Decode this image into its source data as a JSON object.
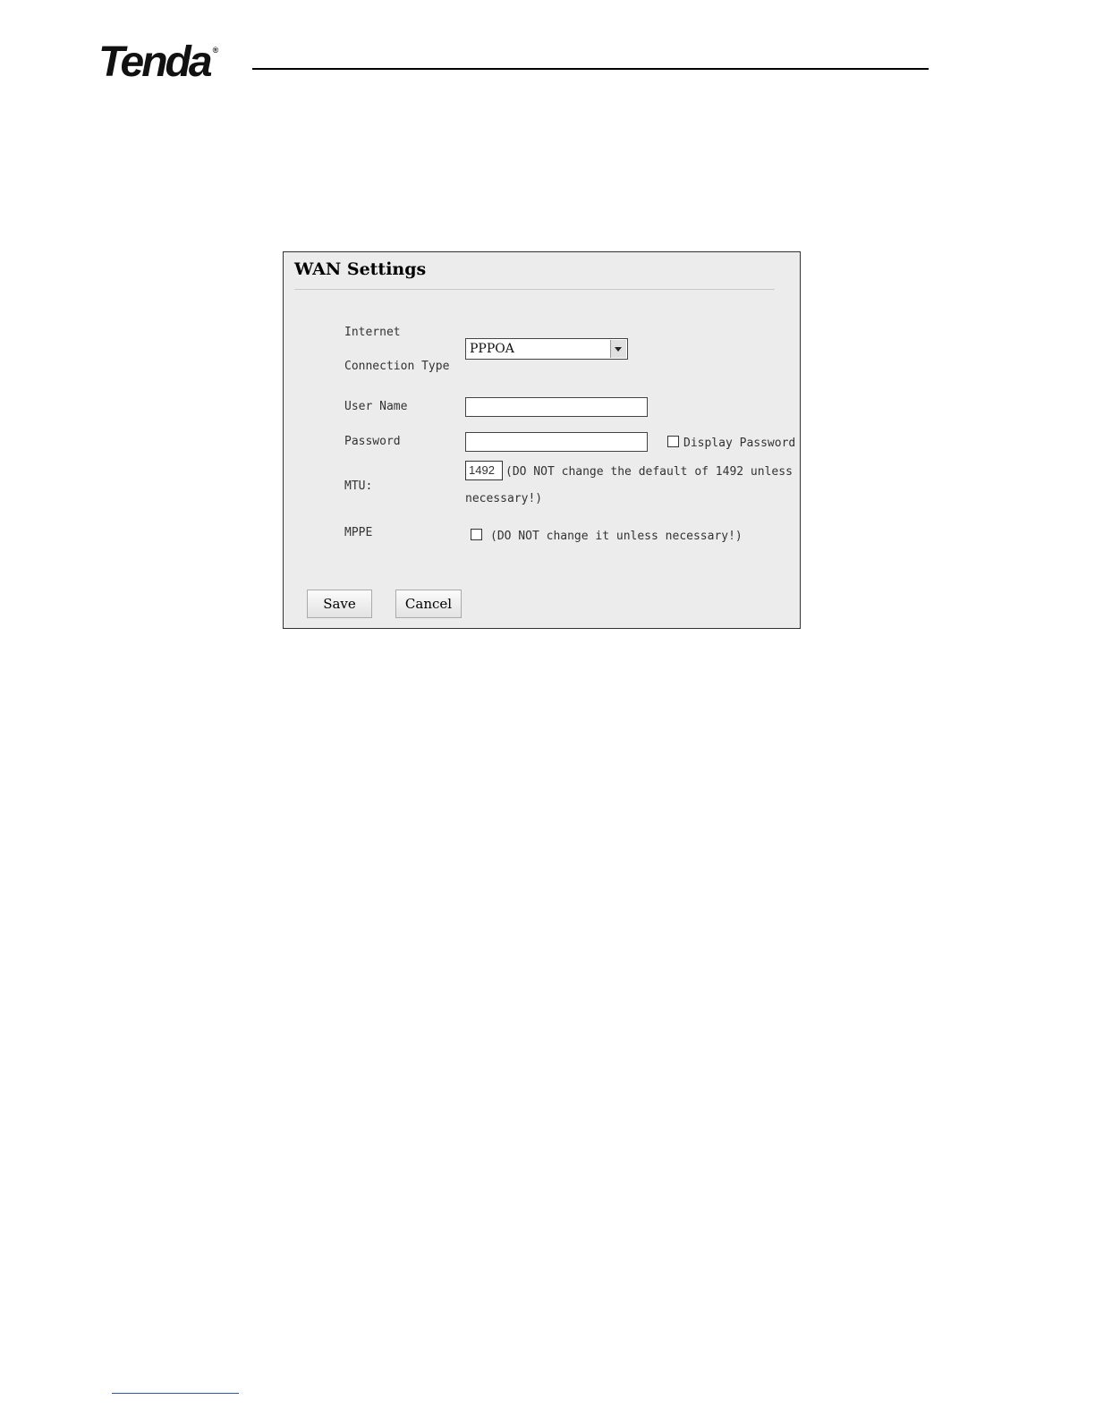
{
  "header": {
    "logo_text": "Tenda",
    "logo_mark": "®"
  },
  "panel": {
    "title": "WAN Settings",
    "connection_type": {
      "label_line1": "Internet",
      "label_line2": "Connection Type",
      "selected": "PPPOA"
    },
    "user_name": {
      "label": "User Name",
      "value": ""
    },
    "password": {
      "label": "Password",
      "value": "",
      "display_label": "Display Password"
    },
    "mtu": {
      "label": "MTU:",
      "value": "1492",
      "note_line1": "(DO NOT change the default of 1492 unless",
      "note_line2": "necessary!)"
    },
    "mppe": {
      "label": "MPPE",
      "note": "(DO NOT change it unless necessary!)"
    },
    "buttons": {
      "save": "Save",
      "cancel": "Cancel"
    }
  }
}
